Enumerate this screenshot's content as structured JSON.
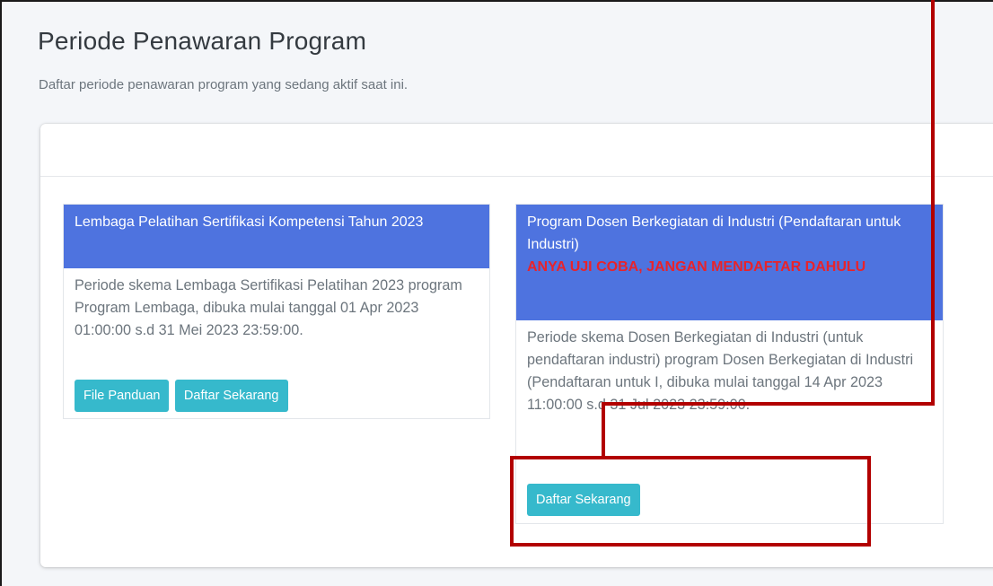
{
  "page": {
    "title": "Periode Penawaran Program",
    "subtitle": "Daftar periode penawaran program yang sedang aktif saat ini."
  },
  "programs": [
    {
      "title": "Lembaga Pelatihan Sertifikasi Kompetensi Tahun 2023",
      "warning": "",
      "description": "Periode skema Lembaga Sertifikasi Pelatihan 2023 program Program Lembaga, dibuka mulai tanggal 01 Apr 2023 01:00:00 s.d 31 Mei 2023 23:59:00.",
      "buttons": [
        "File Panduan",
        "Daftar Sekarang"
      ]
    },
    {
      "title": "Program Dosen Berkegiatan di Industri (Pendaftaran untuk Industri)",
      "warning": "ANYA UJI COBA, JANGAN MENDAFTAR DAHULU",
      "description": "Periode skema Dosen Berkegiatan di Industri (untuk pendaftaran industri) program Dosen Berkegiatan di Industri (Pendaftaran untuk I, dibuka mulai tanggal 14 Apr 2023 11:00:00 s.d 31 Jul 2023 23:59:00.",
      "buttons": [
        "Daftar Sekarang"
      ]
    }
  ],
  "colors": {
    "card_header": "#4e73df",
    "button": "#36b9cc",
    "warning_text": "#e8232b",
    "annotation": "#b20000"
  }
}
